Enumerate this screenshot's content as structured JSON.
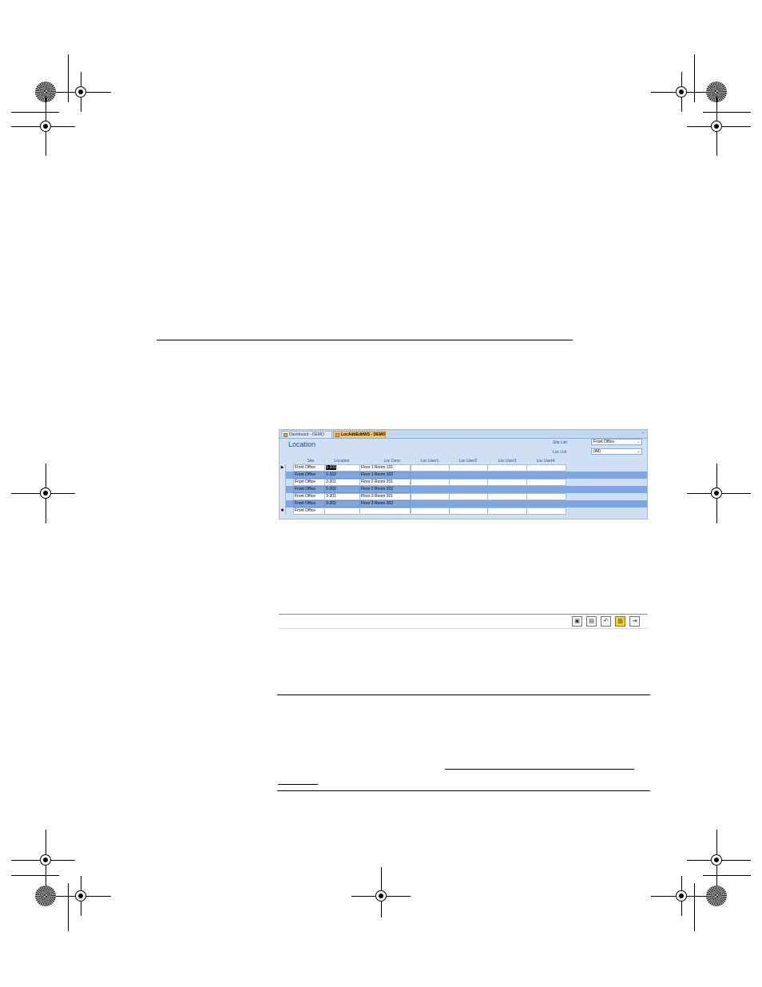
{
  "window": {
    "tabs": [
      {
        "label": "Dashboard - DEMO",
        "active": false
      },
      {
        "label": "LocAddEditWS - DEMO",
        "active": true
      }
    ],
    "close_symbol": "×",
    "form_title": "Location",
    "filters": {
      "site_list_label": "Site List",
      "site_list_value": "Front Office",
      "loc_list_label": "Loc List",
      "loc_list_value": "(All)"
    },
    "columns": [
      "Site",
      "Location",
      "Loc Desc",
      "Loc User1",
      "Loc User2",
      "Loc User3",
      "Loc User4"
    ],
    "rows": [
      {
        "marker": "▶",
        "site": "Front Office",
        "location": "1-101",
        "desc": "Floor 1 Room 101"
      },
      {
        "marker": "",
        "site": "Front Office",
        "location": "1-102",
        "desc": "Floor 1 Room 102"
      },
      {
        "marker": "",
        "site": "Front Office",
        "location": "2-201",
        "desc": "Floor 2 Room 201"
      },
      {
        "marker": "",
        "site": "Front Office",
        "location": "2-202",
        "desc": "Floor 2 Room 202"
      },
      {
        "marker": "",
        "site": "Front Office",
        "location": "3-301",
        "desc": "Floor 3 Room 301"
      },
      {
        "marker": "",
        "site": "Front Office",
        "location": "3-302",
        "desc": "Floor 3 Room 302"
      },
      {
        "marker": "✱",
        "site": "Front Office",
        "location": "",
        "desc": ""
      }
    ],
    "dropdown_arrow": "⌄"
  },
  "toolbar": {
    "buttons": [
      {
        "name": "new-record-icon",
        "glyph": "▣"
      },
      {
        "name": "save-record-icon",
        "glyph": "▤"
      },
      {
        "name": "undo-icon",
        "glyph": "↶"
      },
      {
        "name": "delete-icon",
        "glyph": "▥"
      },
      {
        "name": "exit-icon",
        "glyph": "⇥"
      }
    ]
  },
  "colors": {
    "tab_active": "#f7c45a",
    "form_background": "#cfe0f5",
    "alt_row": "#7fa6e0"
  }
}
